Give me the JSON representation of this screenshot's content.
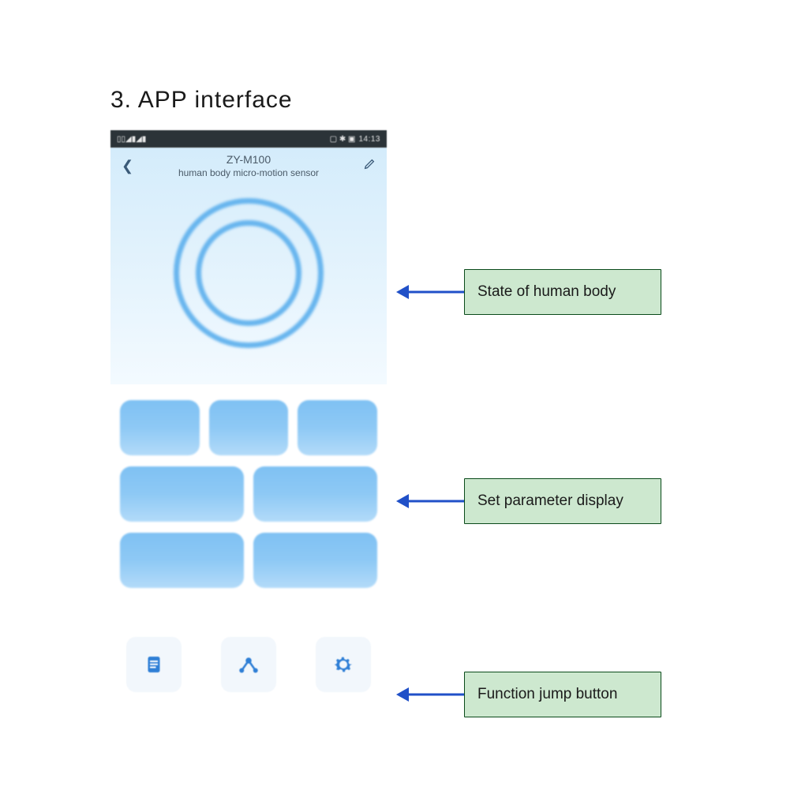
{
  "heading": "3. APP interface",
  "status": {
    "time": "14:13",
    "icons_left": "▯▯◢▮◢▮",
    "icons_right": "▢ ✱ ▣"
  },
  "hero": {
    "title": "ZY-M100",
    "subtitle": "human body micro-motion sensor"
  },
  "callouts": {
    "state": "State of human body",
    "params": "Set parameter display",
    "func": "Function jump button"
  },
  "func_icons": {
    "log": "log-icon",
    "scene": "scene-icon",
    "settings": "settings-icon"
  }
}
